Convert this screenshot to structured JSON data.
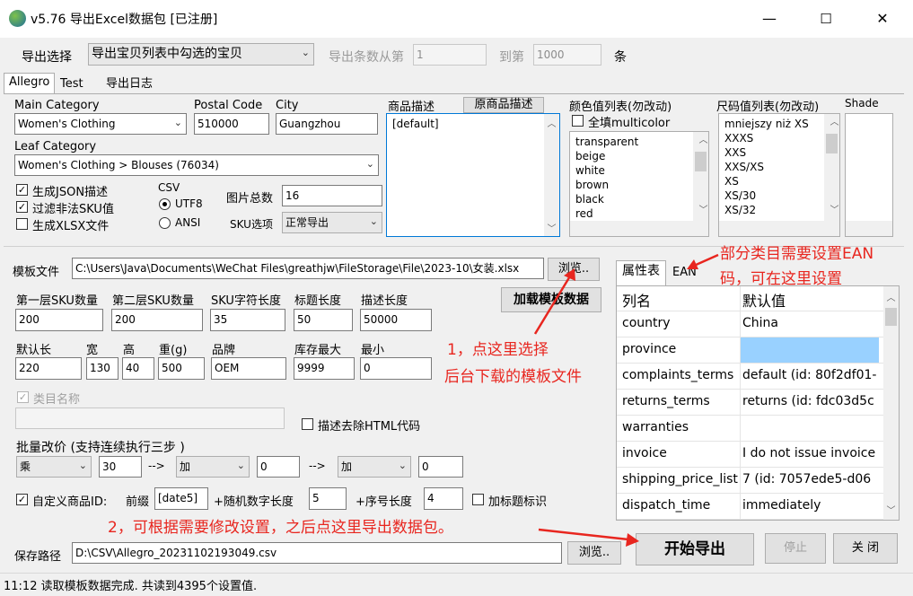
{
  "window": {
    "title": "v5.76 导出Excel数据包 [已注册]",
    "min": "—",
    "max": "☐",
    "close": "✕"
  },
  "export": {
    "label": "导出选择",
    "mode": "导出宝贝列表中勾选的宝贝",
    "from_label": "导出条数从第",
    "from": "1",
    "to_label": "到第",
    "to": "1000",
    "unit": "条"
  },
  "tabs": {
    "t1": "Allegro",
    "t2": "Test",
    "t3": "导出日志"
  },
  "category": {
    "main_label": "Main Category",
    "main_value": "Women's Clothing",
    "postal_label": "Postal Code",
    "postal_value": "510000",
    "city_label": "City",
    "city_value": "Guangzhou",
    "leaf_label": "Leaf Category",
    "leaf_value": "Women's Clothing > Blouses (76034)"
  },
  "desc": {
    "label": "商品描述",
    "orig_btn": "原商品描述",
    "value": "[default]"
  },
  "color": {
    "label": "颜色值列表(勿改动)",
    "fill_label": "全填multicolor",
    "items": [
      "transparent",
      "beige",
      "white",
      "brown",
      "black",
      "red"
    ]
  },
  "size": {
    "label": "尺码值列表(勿改动)",
    "items": [
      "mniejszy niż XS",
      "XXXS",
      "XXS",
      "XXS/XS",
      "XS",
      "XS/30",
      "XS/32"
    ]
  },
  "shade": {
    "label": "Shade"
  },
  "options": {
    "json": "生成JSON描述",
    "filter": "过滤非法SKU值",
    "xlsx": "生成XLSX文件",
    "csv_label": "CSV",
    "utf8": "UTF8",
    "ansi": "ANSI",
    "pics_label": "图片总数",
    "pics": "16",
    "sku_label": "SKU选项",
    "sku_value": "正常导出"
  },
  "template": {
    "label": "模板文件",
    "path": "C:\\Users\\Java\\Documents\\WeChat Files\\greathjw\\FileStorage\\File\\2023-10\\女装.xlsx",
    "browse": "浏览..",
    "load": "加载模板数据"
  },
  "fields": {
    "sku1": "第一层SKU数量",
    "sku1_v": "200",
    "sku2": "第二层SKU数量",
    "sku2_v": "200",
    "skulen": "SKU字符长度",
    "skulen_v": "35",
    "titlelen": "标题长度",
    "titlelen_v": "50",
    "desclen": "描述长度",
    "desclen_v": "50000",
    "len": "默认长",
    "len_v": "220",
    "width": "宽",
    "width_v": "130",
    "height": "高",
    "height_v": "40",
    "weight": "重(g)",
    "weight_v": "500",
    "brand": "品牌",
    "brand_v": "OEM",
    "stockmax": "库存最大",
    "stockmax_v": "9999",
    "stockmin": "最小",
    "stockmin_v": "0"
  },
  "catname": {
    "label": "类目名称",
    "value": ""
  },
  "strip_html": "描述去除HTML代码",
  "batch": {
    "label": "批量改价 (支持连续执行三步 )",
    "op1": "乘",
    "v1": "30",
    "arrow": "-->",
    "op2": "加",
    "v2": "0",
    "op3": "加",
    "v3": "0"
  },
  "custom_id": {
    "label": "自定义商品ID:",
    "prefix_label": "前缀",
    "prefix": "[date5]",
    "rand_label": "+随机数字长度",
    "rand": "5",
    "seq_label": "+序号长度",
    "seq": "4",
    "mark": "加标题标识"
  },
  "save": {
    "label": "保存路径",
    "path": "D:\\CSV\\Allegro_20231102193049.csv",
    "browse": "浏览.."
  },
  "actions": {
    "start": "开始导出",
    "stop": "停止",
    "close": "关 闭"
  },
  "props": {
    "tab1": "属性表",
    "tab2": "EAN",
    "col1": "列名",
    "col2": "默认值",
    "rows": [
      [
        "country",
        "China"
      ],
      [
        "province",
        ""
      ],
      [
        "complaints_terms",
        "default (id: 80f2df01-"
      ],
      [
        "returns_terms",
        "returns (id: fdc03d5c"
      ],
      [
        "warranties",
        ""
      ],
      [
        "invoice",
        "I do not issue invoice"
      ],
      [
        "shipping_price_list",
        "7 (id: 7057ede5-d06"
      ],
      [
        "dispatch_time",
        "immediately"
      ]
    ]
  },
  "notes": {
    "n1a": "1，点这里选择",
    "n1b": "后台下载的模板文件",
    "n2": "2，可根据需要修改设置，之后点这里导出数据包。",
    "n3a": "部分类目需要设置EAN",
    "n3b": "码，可在这里设置"
  },
  "status": "11:12 读取模板数据完成. 共读到4395个设置值."
}
